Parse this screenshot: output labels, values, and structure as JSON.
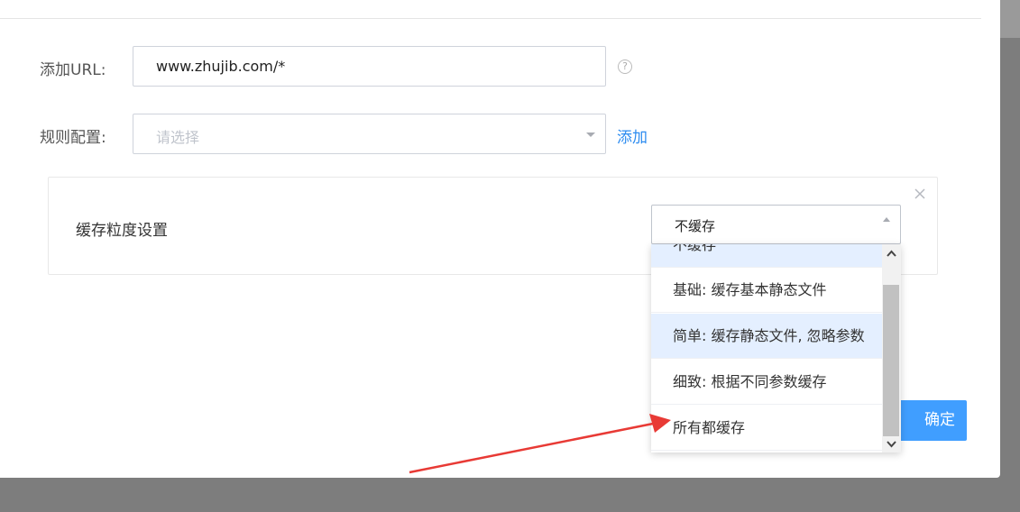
{
  "form": {
    "url_label": "添加URL:",
    "url_value": "www.zhujib.com/*",
    "rule_label": "规则配置:",
    "rule_placeholder": "请选择",
    "add_link": "添加"
  },
  "cache_panel": {
    "label": "缓存粒度设置",
    "selected": "不缓存",
    "options": [
      {
        "label": "不缓存",
        "highlighted": true
      },
      {
        "label": "基础: 缓存基本静态文件",
        "highlighted": false
      },
      {
        "label": "简单: 缓存静态文件, 忽略参数",
        "highlighted": true
      },
      {
        "label": "细致: 根据不同参数缓存",
        "highlighted": false
      },
      {
        "label": "所有都缓存",
        "highlighted": false
      }
    ]
  },
  "footer": {
    "confirm_label": "确定"
  },
  "icons": {
    "help": "question-circle-icon",
    "close": "close-icon",
    "select_caret": "chevron-down-icon",
    "open_caret": "chevron-up-icon"
  },
  "colors": {
    "primary": "#409eff",
    "link": "#2d8cf0",
    "option_highlight": "#e4efff",
    "annotation_arrow": "#e83a35"
  }
}
